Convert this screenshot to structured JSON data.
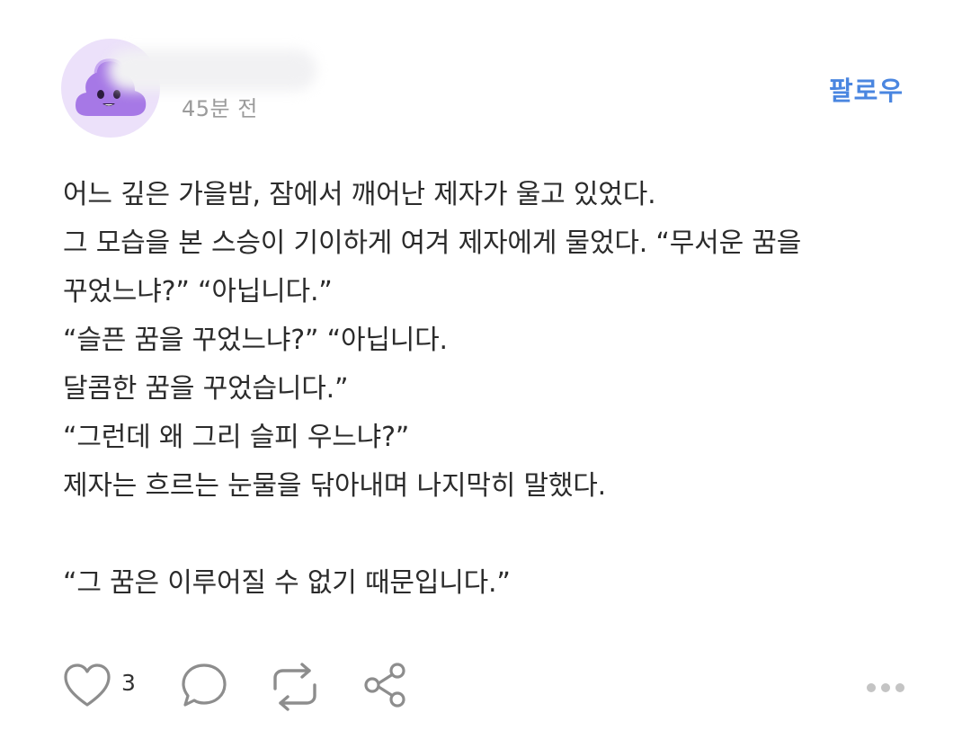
{
  "header": {
    "time": "45분 전",
    "follow_label": "팔로우"
  },
  "content": {
    "lines": [
      "어느 깊은 가을밤, 잠에서 깨어난 제자가 울고 있었다.",
      "그 모습을 본 스승이 기이하게 여겨 제자에게 물었다. “무서운 꿈을",
      "꾸었느냐?” “아닙니다.”",
      "“슬픈 꿈을 꾸었느냐?” “아닙니다.",
      "달콤한 꿈을 꾸었습니다.”",
      "“그런데 왜 그리 슬피 우느냐?”",
      "제자는 흐르는 눈물을 닦아내며 나지막히 말했다.",
      "",
      "“그 꿈은 이루어질 수 없기 때문입니다.”"
    ]
  },
  "actions": {
    "like_count": "3",
    "icons": [
      "heart-icon",
      "comment-icon",
      "repost-icon",
      "share-icon",
      "more-icon"
    ]
  },
  "colors": {
    "accent": "#4a86e0",
    "avatar_bg": "#ece1fa",
    "mascot": "#a678e6",
    "icon": "#8d8d8d"
  }
}
